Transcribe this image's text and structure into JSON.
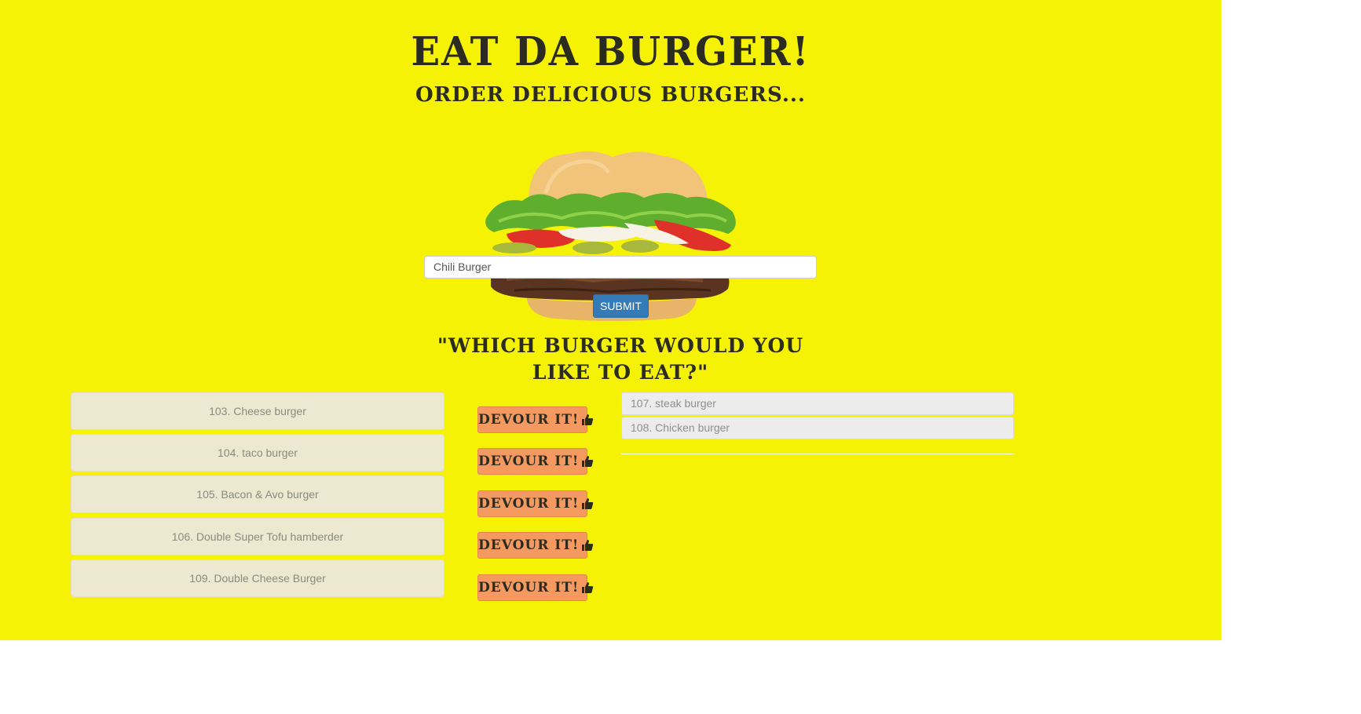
{
  "header": {
    "title": "EAT DA BURGER!",
    "subtitle": "ORDER DELICIOUS BURGERS..."
  },
  "form": {
    "input_value": "Chili Burger",
    "submit_label": "SUBMIT"
  },
  "question": "\"WHICH BURGER WOULD YOU LIKE TO EAT?\"",
  "uneaten": [
    {
      "label": "103. Cheese burger",
      "button": "DEVOUR IT!"
    },
    {
      "label": "104. taco burger",
      "button": "DEVOUR IT!"
    },
    {
      "label": "105. Bacon & Avo burger",
      "button": "DEVOUR IT!"
    },
    {
      "label": "106. Double Super Tofu hamberder",
      "button": "DEVOUR IT!"
    },
    {
      "label": "109. Double Cheese Burger",
      "button": "DEVOUR IT!"
    }
  ],
  "devoured": [
    {
      "label": "107. steak burger"
    },
    {
      "label": "108. Chicken burger"
    }
  ],
  "icons": {
    "devour_icon": "thumbs-up-icon",
    "hero_image": "burger-image"
  },
  "colors": {
    "background": "#f5f205",
    "devour_button": "#f49a61",
    "submit_button": "#337ab7",
    "uneaten_item": "#ece9d0",
    "devoured_item": "#ececec"
  }
}
